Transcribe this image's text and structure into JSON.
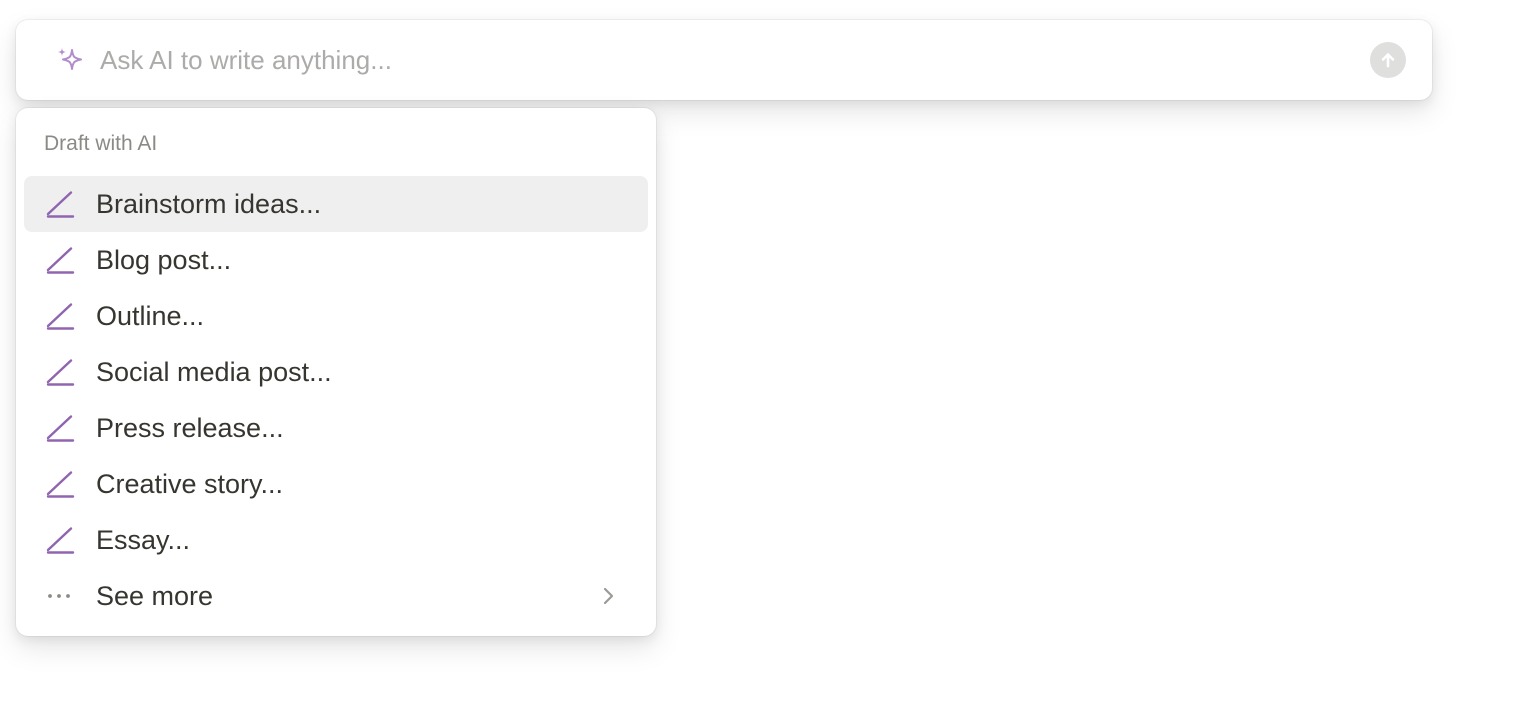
{
  "ai_bar": {
    "placeholder": "Ask AI to write anything...",
    "icon": "sparkle-icon",
    "submit_icon": "arrow-up-icon"
  },
  "menu": {
    "header": "Draft with AI",
    "items": [
      {
        "label": "Brainstorm ideas...",
        "icon": "pencil-icon",
        "highlighted": true
      },
      {
        "label": "Blog post...",
        "icon": "pencil-icon"
      },
      {
        "label": "Outline...",
        "icon": "pencil-icon"
      },
      {
        "label": "Social media post...",
        "icon": "pencil-icon"
      },
      {
        "label": "Press release...",
        "icon": "pencil-icon"
      },
      {
        "label": "Creative story...",
        "icon": "pencil-icon"
      },
      {
        "label": "Essay...",
        "icon": "pencil-icon"
      }
    ],
    "see_more": {
      "label": "See more",
      "icon": "more-dots-icon",
      "chevron": "chevron-right-icon"
    }
  },
  "colors": {
    "accent_purple": "#9065b0",
    "highlight_bg": "#efefef",
    "text": "#37352f",
    "muted": "#8b8a86"
  }
}
